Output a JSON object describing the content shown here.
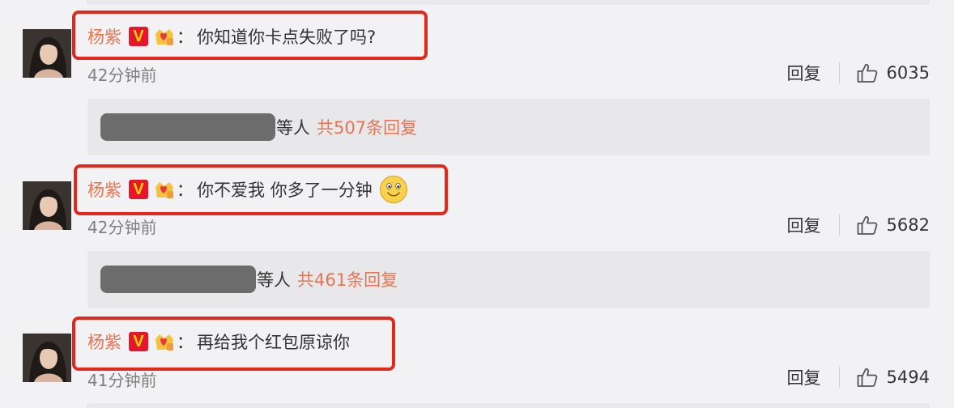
{
  "comments": [
    {
      "username": "杨紫",
      "verified_badge": "V",
      "member_icon": "crown-heart-icon",
      "colon": "：",
      "text": "你知道你卡点失败了吗?",
      "time": "42分钟前",
      "reply_label": "回复",
      "likes": "6035",
      "replies": {
        "suffix": "等人",
        "total_label": "共507条回复"
      }
    },
    {
      "username": "杨紫",
      "verified_badge": "V",
      "member_icon": "crown-heart-icon",
      "colon": "：",
      "text": "你不爱我 你多了一分钟",
      "emoji": "smiley-face-icon",
      "time": "42分钟前",
      "reply_label": "回复",
      "likes": "5682",
      "replies": {
        "suffix": "等人",
        "total_label": "共461条回复"
      }
    },
    {
      "username": "杨紫",
      "verified_badge": "V",
      "member_icon": "crown-heart-icon",
      "colon": "：",
      "text": "再给我个红包原谅你",
      "time": "41分钟前",
      "reply_label": "回复",
      "likes": "5494"
    }
  ],
  "colors": {
    "username": "#eb7350",
    "highlight": "#e3281b",
    "verified_bg": "#e6162d",
    "verified_fg": "#ffd200"
  }
}
